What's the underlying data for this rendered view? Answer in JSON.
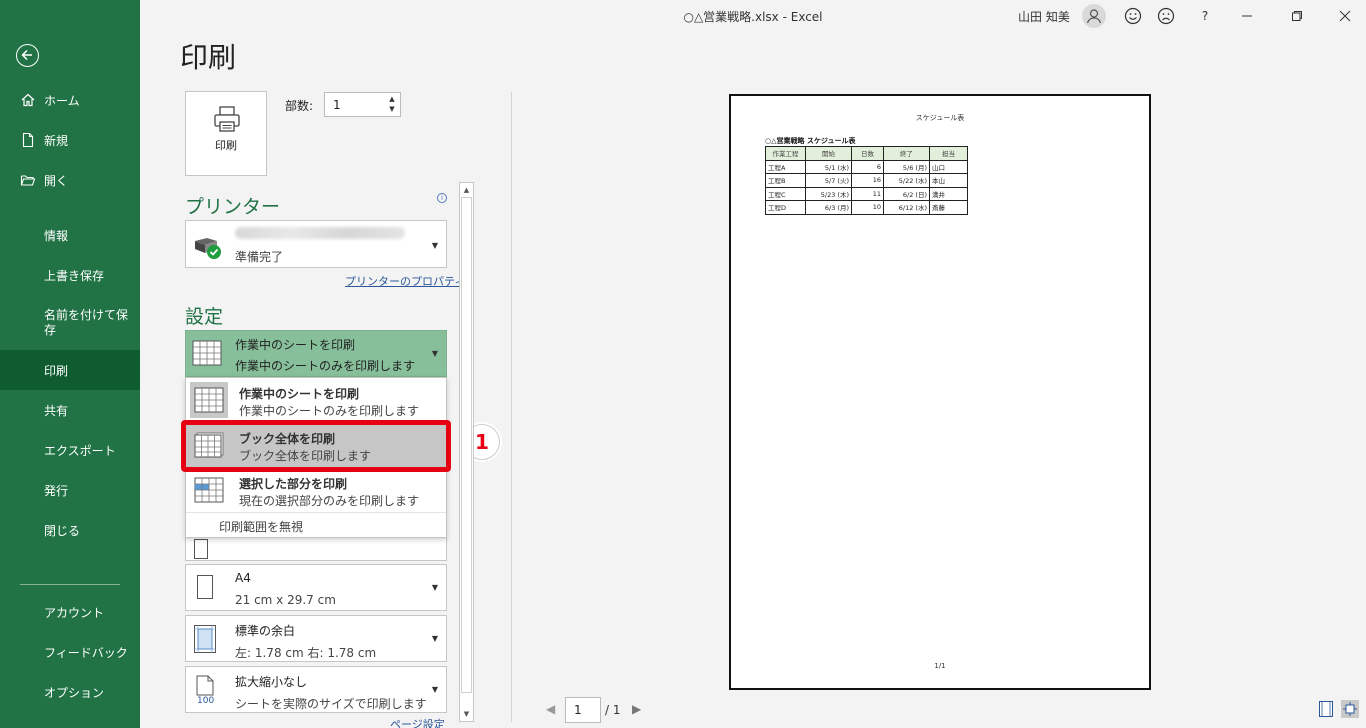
{
  "window": {
    "title": "○△営業戦略.xlsx  -  Excel",
    "user": "山田 知美",
    "help": "?"
  },
  "sidebar": {
    "items": [
      {
        "label": "ホーム"
      },
      {
        "label": "新規"
      },
      {
        "label": "開く"
      },
      {
        "label": "情報"
      },
      {
        "label": "上書き保存"
      },
      {
        "label": "名前を付けて保存"
      },
      {
        "label": "印刷"
      },
      {
        "label": "共有"
      },
      {
        "label": "エクスポート"
      },
      {
        "label": "発行"
      },
      {
        "label": "閉じる"
      },
      {
        "label": "アカウント"
      },
      {
        "label": "フィードバック"
      },
      {
        "label": "オプション"
      }
    ]
  },
  "print": {
    "title": "印刷",
    "button_label": "印刷",
    "copies_label": "部数:",
    "copies_value": "1"
  },
  "printer": {
    "heading": "プリンター",
    "status": "準備完了",
    "properties_link": "プリンターのプロパティ"
  },
  "settings": {
    "heading": "設定",
    "selected": {
      "title": "作業中のシートを印刷",
      "desc": "作業中のシートのみを印刷します"
    },
    "options": [
      {
        "title": "作業中のシートを印刷",
        "desc": "作業中のシートのみを印刷します"
      },
      {
        "title": "ブック全体を印刷",
        "desc": "ブック全体を印刷します"
      },
      {
        "title": "選択した部分を印刷",
        "desc": "現在の選択部分のみを印刷します"
      }
    ],
    "ignore_print_area": "印刷範囲を無視",
    "paper": {
      "title": "A4",
      "desc": "21 cm x 29.7 cm"
    },
    "margins": {
      "title": "標準の余白",
      "desc": "左:  1.78 cm     右:  1.78 cm"
    },
    "scaling": {
      "title": "拡大縮小なし",
      "desc": "シートを実際のサイズで印刷します"
    },
    "page_setup_link": "ページ設定"
  },
  "callout": {
    "number": "1",
    "color": "#e60012"
  },
  "preview": {
    "sheet_title": "スケジュール表",
    "table_title": "○△営業戦略 スケジュール表",
    "headers": [
      "作業工程",
      "開始",
      "日数",
      "終了",
      "担当"
    ],
    "rows": [
      [
        "工程A",
        "5/1 (水)",
        "6",
        "5/6 (月)",
        "山口"
      ],
      [
        "工程B",
        "5/7 (火)",
        "16",
        "5/22 (水)",
        "本山"
      ],
      [
        "工程C",
        "5/23 (木)",
        "11",
        "6/2 (日)",
        "満井"
      ],
      [
        "工程D",
        "6/3 (月)",
        "10",
        "6/12 (水)",
        "斎藤"
      ]
    ],
    "page_number": "1/1"
  },
  "pager": {
    "current": "1",
    "total": "/ 1"
  },
  "colors": {
    "excel_green": "#217346",
    "active_nav": "#0e5c2f",
    "selected_option": "#86bf9a"
  }
}
